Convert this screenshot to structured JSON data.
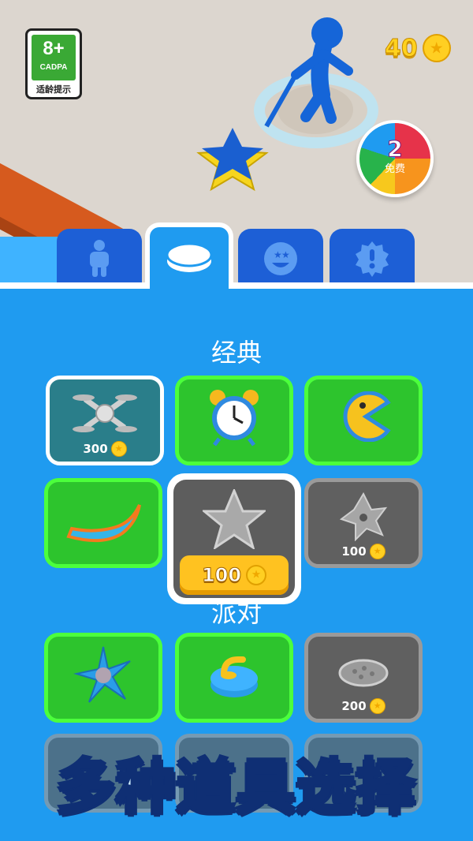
{
  "rating": {
    "age": "8+",
    "org": "CADPA",
    "tip": "适龄提示"
  },
  "wallet": {
    "coins": "40",
    "coin_icon": "star-coin-icon"
  },
  "spin_wheel": {
    "count": "2",
    "label": "免费"
  },
  "tabs": [
    {
      "icon": "character-icon",
      "active": false
    },
    {
      "icon": "disc-icon",
      "active": true
    },
    {
      "icon": "emoji-icon",
      "active": false
    },
    {
      "icon": "badge-icon",
      "active": false
    }
  ],
  "sections": [
    {
      "title": "经典"
    },
    {
      "title": "派对"
    }
  ],
  "items_classic": [
    {
      "name": "drone",
      "price": "300"
    },
    {
      "name": "alarm-clock",
      "price": ""
    },
    {
      "name": "pac-disc",
      "price": ""
    },
    {
      "name": "boomerang",
      "price": ""
    },
    {
      "name": "star-disc",
      "price": "100"
    },
    {
      "name": "shuriken-flower",
      "price": "100"
    }
  ],
  "items_party": [
    {
      "name": "ninja-star",
      "price": ""
    },
    {
      "name": "curling-stone",
      "price": ""
    },
    {
      "name": "pie",
      "price": "200"
    }
  ],
  "banner": {
    "text": "多种道具选择"
  },
  "colors": {
    "accent": "#1f9bf0",
    "owned": "#2dc42d",
    "locked": "#606060",
    "gold": "#ffc220"
  }
}
